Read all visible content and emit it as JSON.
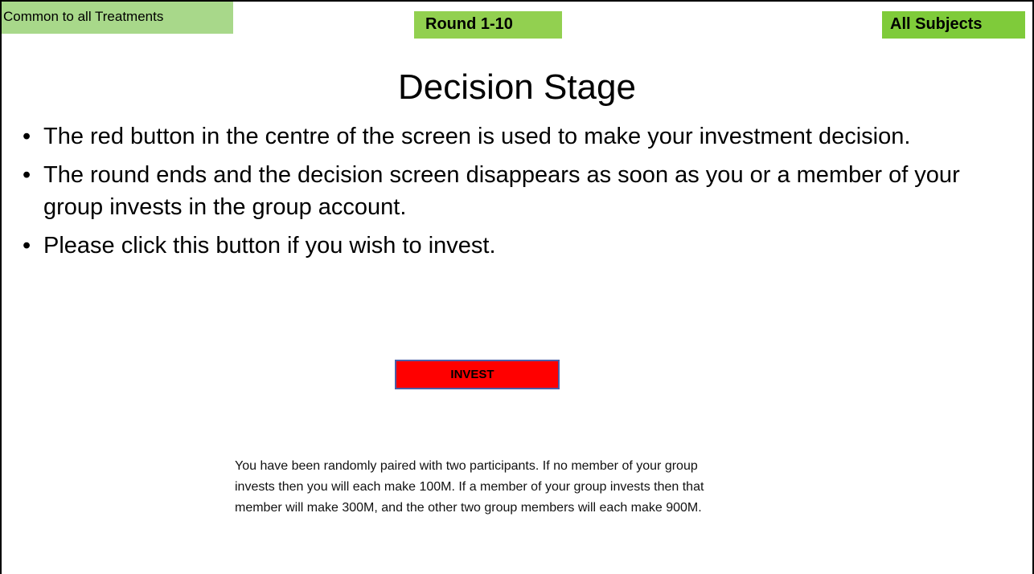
{
  "header": {
    "treatment_label": "Common to all Treatments",
    "round_label": "Round 1-10",
    "subjects_label": "All Subjects"
  },
  "title": "Decision Stage",
  "bullets": [
    "The red button in the centre of the screen is used to make your investment decision.",
    "The round ends and the decision screen disappears as soon as you or a member of your group invests in the group account.",
    "Please click this button if you wish to invest."
  ],
  "invest_button": {
    "label": "INVEST",
    "color": "#ff0000"
  },
  "info_text": "You have been randomly paired with two participants. If no member of your group invests then you will each make 100M. If a member of your group invests then that member will make 300M, and the other two group members will each make 900M.",
  "colors": {
    "tag_green": "#92d050",
    "button_red": "#ff0000"
  }
}
